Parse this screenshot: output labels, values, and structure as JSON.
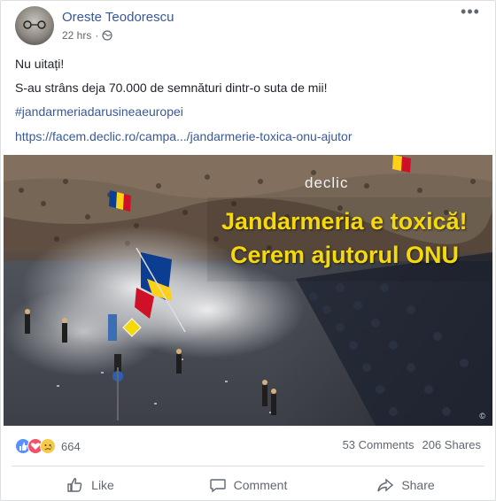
{
  "post": {
    "author": "Oreste Teodorescu",
    "timestamp": "22 hrs",
    "privacy_icon": "globe-icon",
    "more_icon": "more-options-icon"
  },
  "content": {
    "line1": "Nu uitați!",
    "line2": "S-au strâns deja 70.000 de semnături dintr-o suta de mii!",
    "hashtag": "#jandarmeriadarusineaeuropei",
    "url": "https://facem.declic.ro/campa.../jandarmerie-toxica-onu-ajutor"
  },
  "image": {
    "logo_text": "declic",
    "headline_line1": "Jandarmeria e toxică!",
    "headline_line2": "Cerem ajutorul ONU",
    "colors": {
      "headline": "#f5d90a"
    }
  },
  "stats": {
    "reaction_count": "664",
    "comments": "53 Comments",
    "shares": "206 Shares",
    "reaction_icons": [
      "like-reaction-icon",
      "love-reaction-icon",
      "sad-reaction-icon"
    ]
  },
  "actions": {
    "like": "Like",
    "comment": "Comment",
    "share": "Share"
  },
  "colors": {
    "link": "#385898",
    "author": "#365899",
    "meta": "#616770"
  }
}
